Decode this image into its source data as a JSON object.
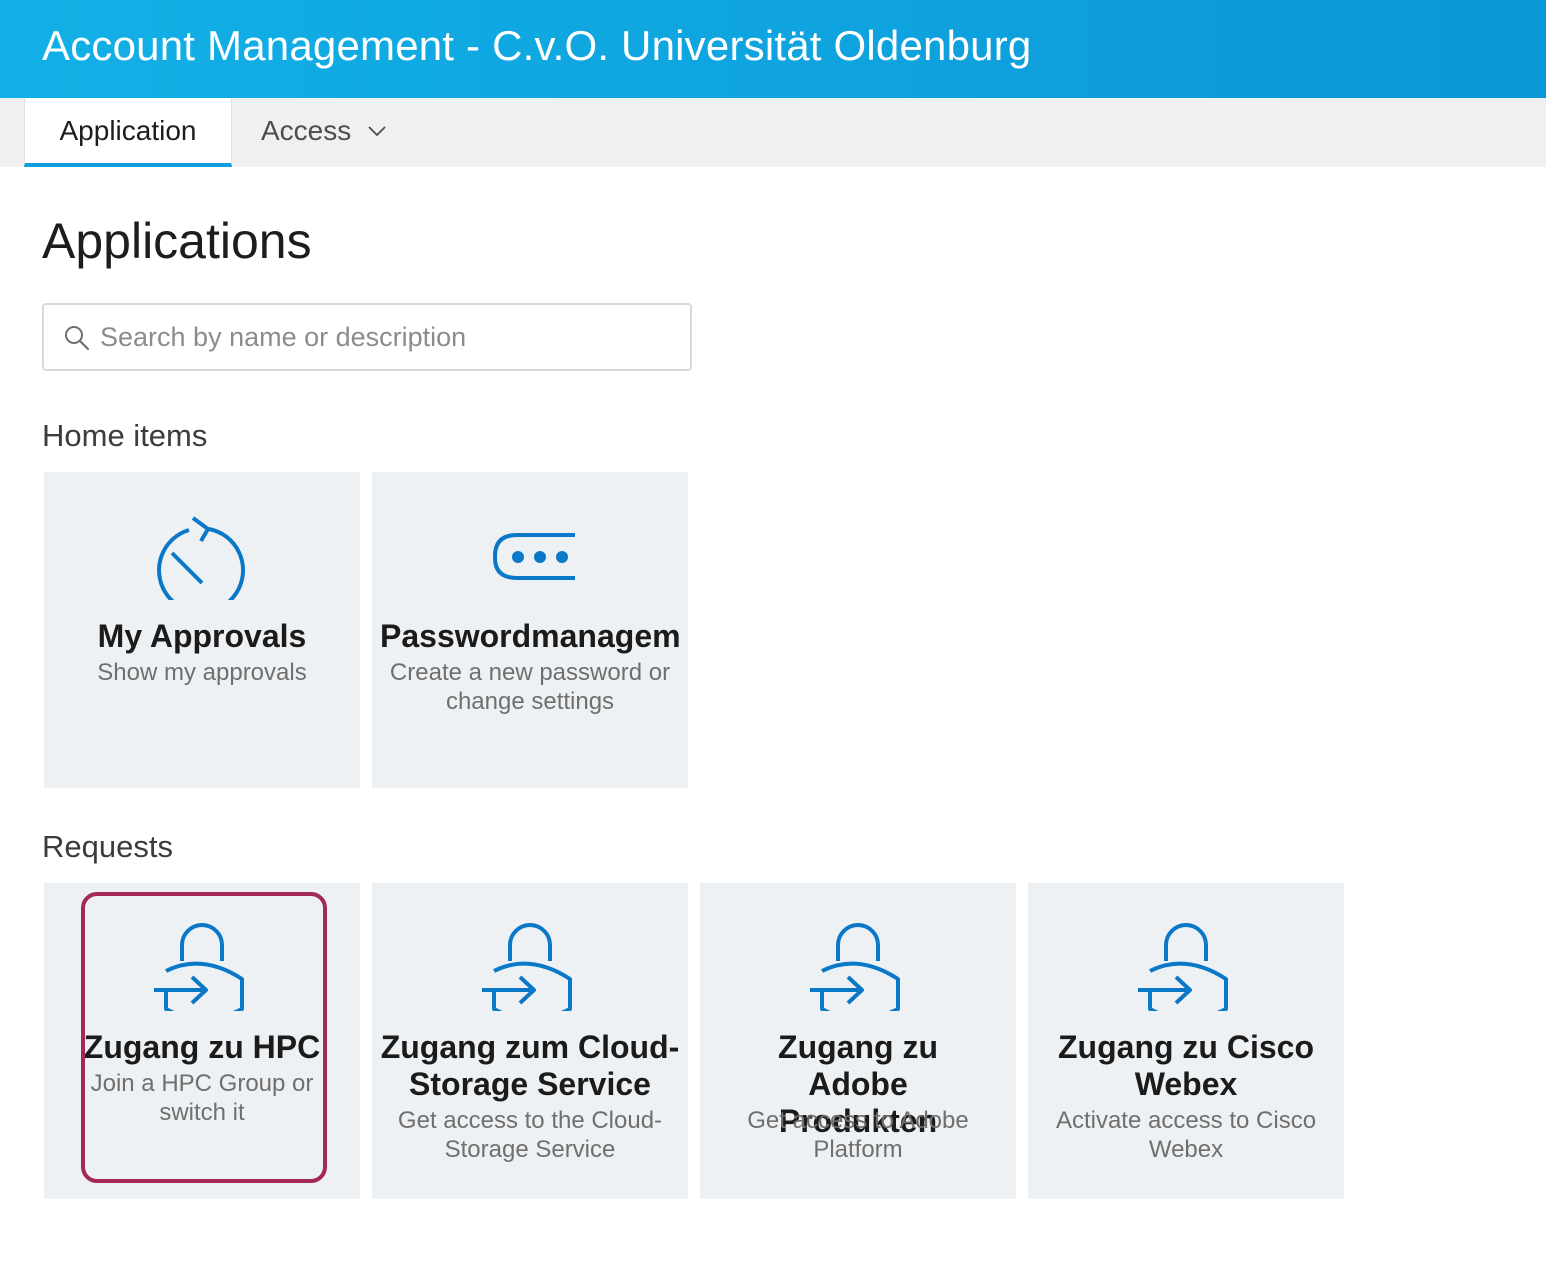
{
  "header": {
    "title": "Account Management - C.v.O. Universität Oldenburg"
  },
  "nav": {
    "tabs": [
      {
        "label": "Application",
        "active": true
      },
      {
        "label": "Access",
        "has_dropdown": true
      }
    ]
  },
  "page": {
    "title": "Applications"
  },
  "search": {
    "placeholder": "Search by name or description",
    "value": ""
  },
  "sections": {
    "home_items": {
      "title": "Home items",
      "tiles": [
        {
          "title": "My Approvals",
          "description": "Show my approvals",
          "icon": "approvals-icon"
        },
        {
          "title": "Passwordmanagem",
          "description": "Create a new password or change settings",
          "icon": "password-icon"
        }
      ]
    },
    "requests": {
      "title": "Requests",
      "tiles": [
        {
          "title": "Zugang zu HPC",
          "description": "Join a HPC Group or switch it",
          "icon": "lock-enter-icon",
          "highlighted": true
        },
        {
          "title": "Zugang zum Cloud-Storage Service",
          "description": "Get access to the Cloud-Storage Service",
          "icon": "lock-enter-icon"
        },
        {
          "title": "Zugang zu Adobe Produkten",
          "description": "Get access to Adobe Platform",
          "icon": "lock-enter-icon"
        },
        {
          "title": "Zugang zu Cisco Webex",
          "description": "Activate access to Cisco Webex",
          "icon": "lock-enter-icon"
        }
      ]
    }
  },
  "colors": {
    "header_bg": "#0fa4df",
    "icon_blue": "#0a78c8",
    "tile_bg": "#eef1f3",
    "highlight_border": "#a3295a",
    "tab_underline": "#0f9fdc"
  }
}
